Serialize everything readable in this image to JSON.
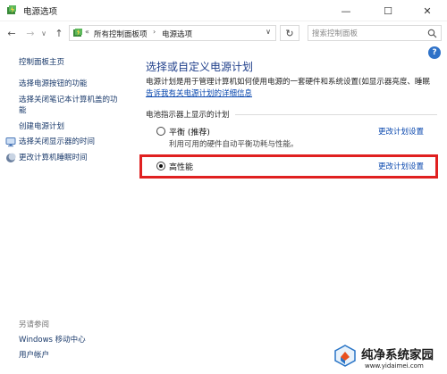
{
  "window": {
    "title": "电源选项",
    "minimize_glyph": "—",
    "maximize_glyph": "☐",
    "close_glyph": "✕"
  },
  "nav": {
    "back_glyph": "←",
    "forward_glyph": "→",
    "history_glyph": "∨",
    "up_glyph": "↑",
    "address": {
      "overflow": "«",
      "crumbs": [
        "所有控制面板项",
        "电源选项"
      ],
      "separator": "›",
      "dropdown_glyph": "∨"
    },
    "refresh_glyph": "↻",
    "search_placeholder": "搜索控制面板"
  },
  "help_glyph": "?",
  "sidebar": {
    "items": [
      {
        "label": "控制面板主页"
      },
      {
        "label": "选择电源按钮的功能"
      },
      {
        "label": "选择关闭笔记本计算机盖的功"
      },
      {
        "label": "能"
      },
      {
        "label": "创建电源计划"
      },
      {
        "label": "选择关闭显示器的时间",
        "icon": "display-power-icon"
      },
      {
        "label": "更改计算机睡眠时间",
        "icon": "moon-sleep-icon"
      }
    ],
    "see_also_label": "另请参阅",
    "see_also_items": [
      {
        "label": "Windows 移动中心"
      },
      {
        "label": "用户帐户"
      }
    ]
  },
  "main": {
    "title": "选择或自定义电源计划",
    "description": "电源计划是用于管理计算机如何使用电源的一套硬件和系统设置(如显示器亮度、睡眠",
    "description_link": "告诉我有关电源计划的详细信息",
    "group_label": "电池指示器上显示的计划",
    "plans": [
      {
        "name": "平衡 (推荐)",
        "description": "利用可用的硬件自动平衡功耗与性能。",
        "change_label": "更改计划设置",
        "selected": false
      },
      {
        "name": "高性能",
        "description": "",
        "change_label": "更改计划设置",
        "selected": true
      }
    ]
  },
  "watermark": {
    "text": "纯净系统家园",
    "url": "www.yidaimei.com"
  },
  "colors": {
    "title_blue": "#1e3e8a",
    "link_blue": "#0645ad",
    "highlight_red": "#e02020"
  }
}
